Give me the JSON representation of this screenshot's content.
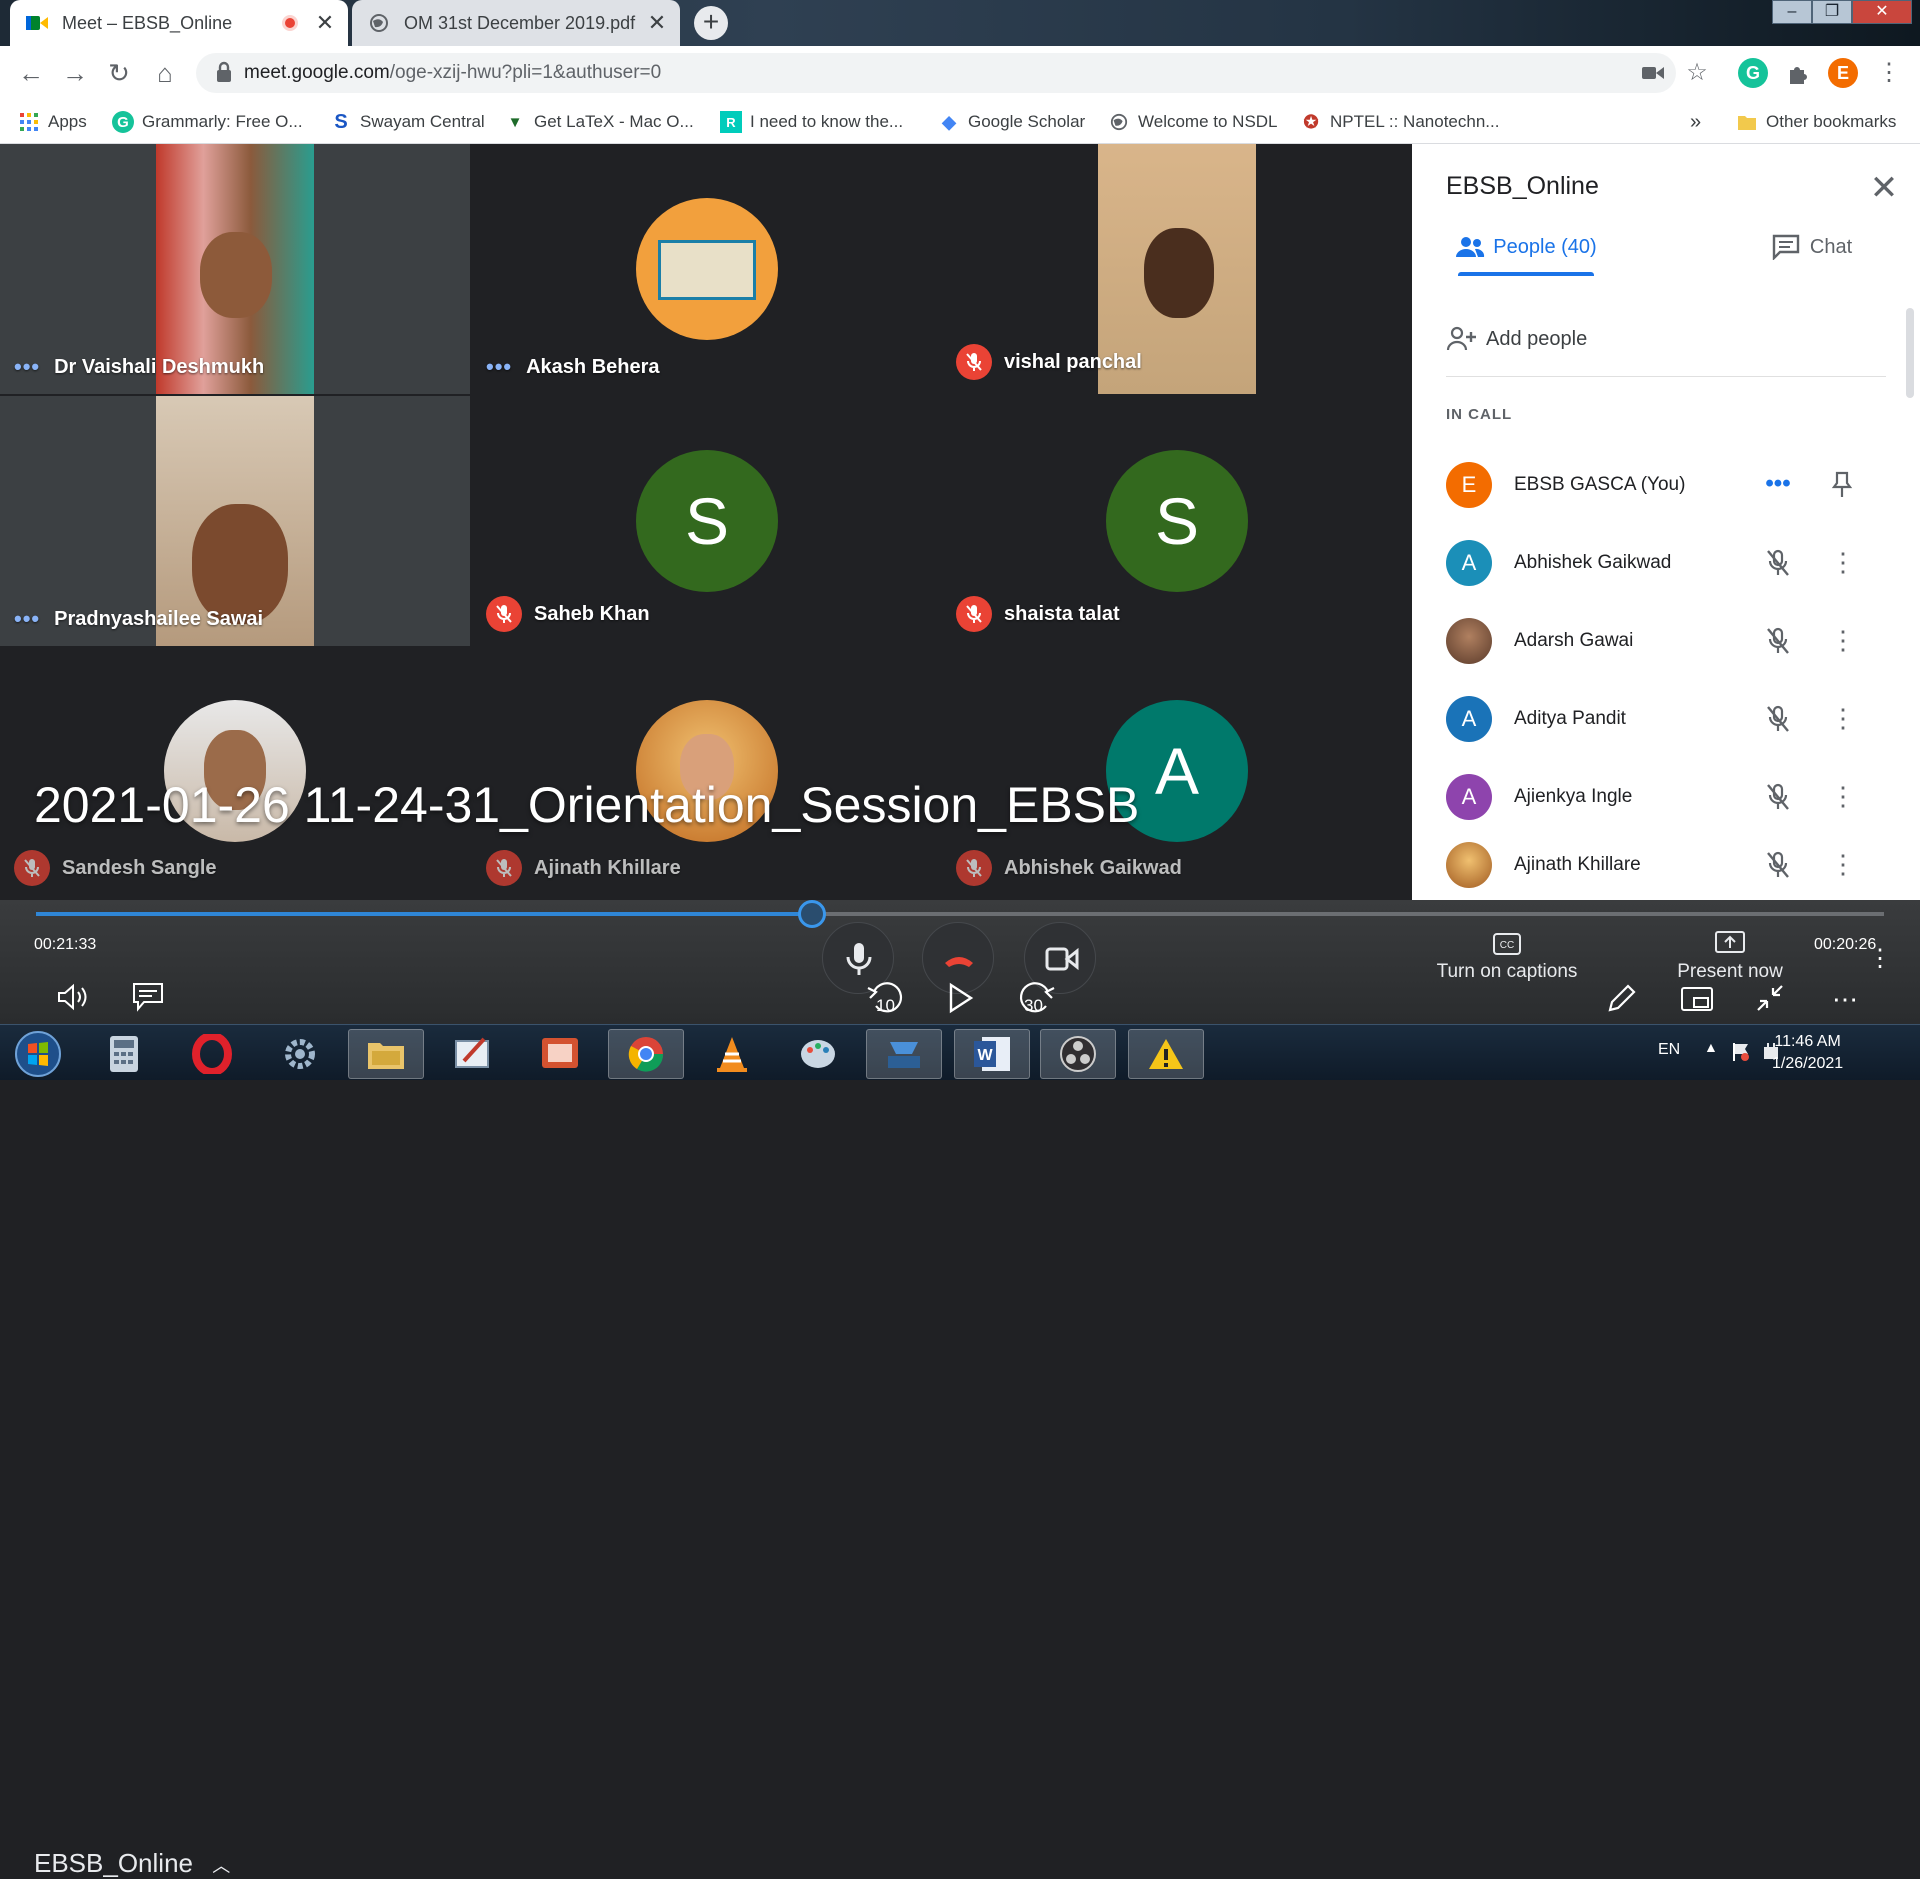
{
  "browser": {
    "tabs": [
      {
        "title": "Meet – EBSB_Online",
        "recording": true
      },
      {
        "title": "OM 31st December 2019.pdf"
      }
    ],
    "url_main": "meet.google.com",
    "url_rest": "/oge-xzij-hwu?pli=1&authuser=0",
    "profile_initial": "E",
    "bookmarks": [
      {
        "label": "Apps",
        "icon": "apps-grid-icon"
      },
      {
        "label": "Grammarly: Free O...",
        "icon": "grammarly-icon"
      },
      {
        "label": "Swayam Central",
        "icon": "swayam-icon"
      },
      {
        "label": "Get LaTeX - Mac O...",
        "icon": "latex-icon"
      },
      {
        "label": "I need to know the...",
        "icon": "researchgate-icon"
      },
      {
        "label": "Google Scholar",
        "icon": "scholar-icon"
      },
      {
        "label": "Welcome to NSDL",
        "icon": "globe-icon"
      },
      {
        "label": "NPTEL :: Nanotechn...",
        "icon": "nptel-icon"
      }
    ],
    "bookmarks_overflow": "»",
    "other_bookmarks": "Other bookmarks"
  },
  "meet": {
    "tiles": [
      {
        "name": "Dr Vaishali Deshmukh",
        "status": "speaking"
      },
      {
        "name": "Akash Behera",
        "status": "speaking"
      },
      {
        "name": "vishal panchal",
        "status": "muted"
      },
      {
        "name": "Pradnyashailee Sawai",
        "status": "speaking"
      },
      {
        "name": "Saheb Khan",
        "status": "muted",
        "initial": "S"
      },
      {
        "name": "shaista talat",
        "status": "muted",
        "initial": "S"
      },
      {
        "name": "Sandesh Sangle",
        "status": "muted"
      },
      {
        "name": "Ajinath Khillare",
        "status": "muted"
      },
      {
        "name": "Abhishek Gaikwad",
        "status": "muted",
        "initial": "A"
      }
    ],
    "panel": {
      "title": "EBSB_Online",
      "people_tab": "People (40)",
      "chat_tab": "Chat",
      "add_people": "Add people",
      "section": "IN CALL",
      "people": [
        {
          "name": "EBSB GASCA (You)",
          "initial": "E",
          "color": "#f36c00"
        },
        {
          "name": "Abhishek Gaikwad",
          "initial": "A",
          "color": "#1b8fb8"
        },
        {
          "name": "Adarsh Gawai",
          "initial": "",
          "color": "#8d6e63"
        },
        {
          "name": "Aditya Pandit",
          "initial": "A",
          "color": "#1a73b8"
        },
        {
          "name": "Ajienkya Ingle",
          "initial": "A",
          "color": "#8e44ad"
        },
        {
          "name": "Ajinath Khillare",
          "initial": "",
          "color": "#c59b5a"
        }
      ]
    },
    "meeting_name": "EBSB_Online",
    "captions_label": "Turn on captions",
    "present_label": "Present now"
  },
  "player": {
    "title": "2021-01-26 11-24-31_Orientation_Session_EBSB",
    "current_time": "00:21:33",
    "remaining_time": "00:20:26",
    "progress": 0.42,
    "skip_back": "10",
    "skip_forward": "30"
  },
  "taskbar": {
    "language": "EN",
    "time": "11:46 AM",
    "date": "1/26/2021"
  },
  "colors": {
    "accent": "#1a73e8",
    "mute_red": "#ea4335",
    "avatar_green": "#33691e",
    "avatar_teal": "#00796b"
  }
}
